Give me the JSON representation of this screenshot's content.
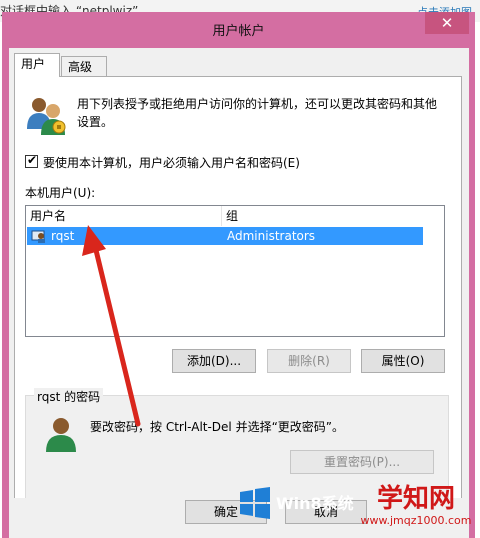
{
  "background": {
    "left_text": "对话框中输入 “netplwiz”",
    "right_text": "点击添加图"
  },
  "dialog": {
    "title": "用户帐户",
    "close_glyph": "✕",
    "tabs": [
      {
        "label": "用户"
      },
      {
        "label": "高级"
      }
    ],
    "intro_text": "用下列表授予或拒绝用户访问你的计算机，还可以更改其密码和其他设置。",
    "require_login": {
      "checked": true,
      "label": "要使用本计算机，用户必须输入用户名和密码(E)"
    },
    "users_label": "本机用户(U):",
    "columns": [
      "用户名",
      "组"
    ],
    "rows": [
      {
        "name": "rqst",
        "group": "Administrators",
        "selected": true
      }
    ],
    "buttons": {
      "add": "添加(D)...",
      "remove": "删除(R)",
      "properties": "属性(O)"
    },
    "password_group": {
      "title": "rqst 的密码",
      "text": "要改密码，按 Ctrl-Alt-Del 并选择“更改密码”。",
      "reset_button": "重置密码(P)..."
    },
    "bottom": {
      "ok": "确定",
      "cancel": "取消"
    }
  },
  "watermark": {
    "logo_text": "Win8系统",
    "site_name": "学知网",
    "site_url": "www.jmqz1000.com"
  },
  "colors": {
    "frame": "#d46ea2",
    "selection": "#3399ff",
    "arrow": "#d9261c"
  }
}
